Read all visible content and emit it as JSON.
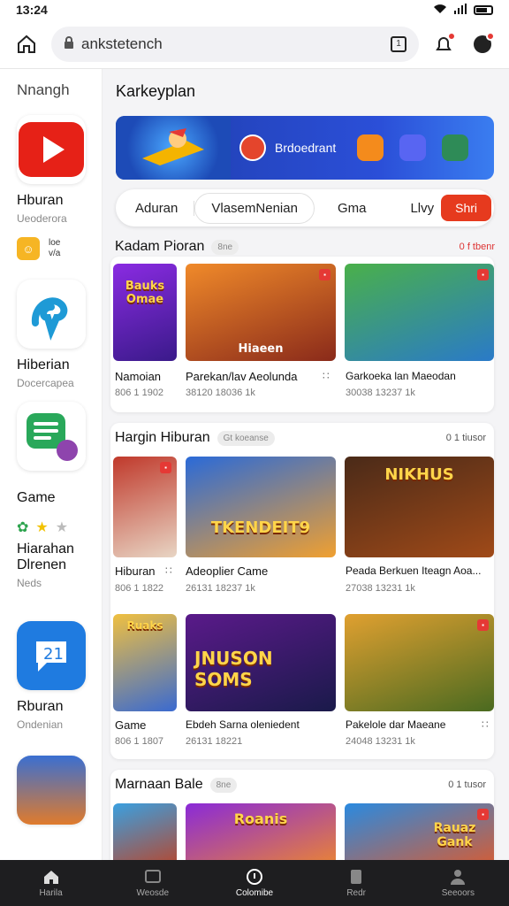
{
  "status": {
    "time": "13:24"
  },
  "address": {
    "url": "ankstetench"
  },
  "sidebar": {
    "title": "Nnangh",
    "apps": [
      {
        "label": "Hburan",
        "sub": "Ueoderora"
      },
      {
        "label": "Hiberian",
        "sub": "Docercapea"
      },
      {
        "label": "Game",
        "sub": ""
      },
      {
        "label": "Hiarahan Dlrenen",
        "sub": "Neds"
      },
      {
        "label": "Rburan",
        "sub": "Ondenian"
      }
    ],
    "small_app": {
      "line1": "loe",
      "line2": "v/a"
    }
  },
  "main": {
    "title": "Karkeyplan",
    "banner": {
      "text": "Brdoedrant"
    },
    "filters": [
      "Aduran",
      "VlasemNenian",
      "Gma",
      "Llvy",
      "Shri"
    ],
    "sections": [
      {
        "title": "Kadam Pioran",
        "chip": "8ne",
        "more": "0 f tbenr",
        "rows": [
          [
            {
              "name": "Namoian",
              "meta": "806 1 1902",
              "art": "Bauks Omae"
            },
            {
              "name": "Parekan/lav Aeolunda",
              "meta": "38120 18036 1k",
              "art": "Hiaeen"
            },
            {
              "name": "Garkoeka lan Maeodan",
              "meta": "30038 13237 1k",
              "art": ""
            }
          ]
        ]
      },
      {
        "title": "Hargin Hiburan",
        "chip": "Gt koeanse",
        "more": "0 1 tiusor",
        "rows": [
          [
            {
              "name": "Hiburan",
              "meta": "806 1 1822",
              "art": ""
            },
            {
              "name": "Adeoplier Came",
              "meta": "26131 18237 1k",
              "art": "TKENDEIT9"
            },
            {
              "name": "Peada Berkuen Iteagn Aoa...",
              "meta": "27038 13231 1k",
              "art": "NIKHUS"
            }
          ],
          [
            {
              "name": "Game",
              "meta": "806 1 1807",
              "art": "Ruaks"
            },
            {
              "name": "Ebdeh Sarna oleniedent",
              "meta": "26131 18221",
              "art": "JNUSON SOMS"
            },
            {
              "name": "Pakelole dar Maeane",
              "meta": "24048 13231 1k",
              "art": ""
            }
          ]
        ]
      },
      {
        "title": "Marnaan Bale",
        "chip": "8ne",
        "more": "0 1 tusor",
        "rows": [
          [
            {
              "name": "",
              "meta": "",
              "art": ""
            },
            {
              "name": "",
              "meta": "",
              "art": "Roanis"
            },
            {
              "name": "",
              "meta": "",
              "art": "Rauaz Gank"
            }
          ]
        ]
      }
    ]
  },
  "bottomnav": [
    {
      "label": "Harila"
    },
    {
      "label": "Weosde"
    },
    {
      "label": "Colomibe"
    },
    {
      "label": "Redr"
    },
    {
      "label": "Seeoors"
    }
  ],
  "colors": {
    "accent": "#e63a1e",
    "banner": "#2546c2",
    "navbar": "#1e1e20"
  }
}
